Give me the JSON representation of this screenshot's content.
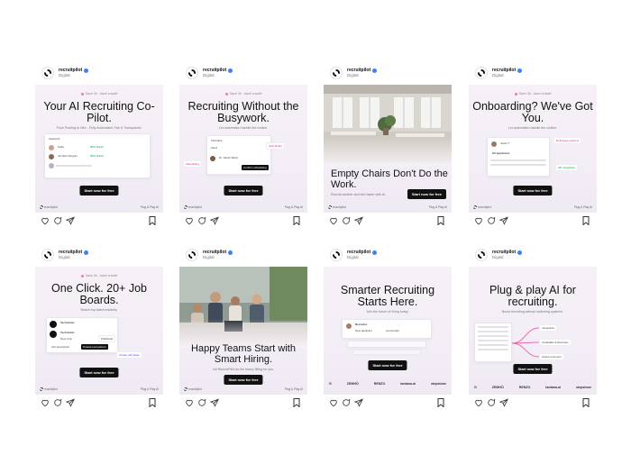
{
  "account": {
    "name": "recruitpilot",
    "subtitle": "Digital"
  },
  "promo_line": "Save 3h - have a seat!",
  "footer": {
    "brand": "recruitpilot",
    "right": "Plug & Play AI"
  },
  "cta_label": "Start now for free",
  "posts": [
    {
      "headline": "Your AI Recruiting Co-Pilot.",
      "subline": "From Posting to Hire - Fully Automated, Fair & Transparent.",
      "mock_labels": [
        "Applicant",
        "Sofia",
        "Jennifer Morgan",
        "98% Match",
        "Score"
      ]
    },
    {
      "headline": "Recruiting Without the Busywork.",
      "subline": "Let automation handle the routine.",
      "mock_labels": [
        "Schedule",
        "Send",
        "Dr. Sarah Ward",
        "Confirm scheduling",
        "Scheduling",
        "Auto-Reply"
      ]
    },
    {
      "headline": "Empty Chairs Don't Do the Work.",
      "subline": "Recruit smarter and hire faster with AI."
    },
    {
      "headline": "Onboarding? We've Got You.",
      "subline": "Let automation handle the routine.",
      "mock_labels": [
        "Justin T",
        "All applicants",
        "Upload",
        "Employee systems",
        "HR integration"
      ]
    },
    {
      "headline": "One Click. 20+ Job Boards.",
      "subline": "Reach top talent instantly.",
      "mock_labels": [
        "Technician",
        "Technician",
        "New York",
        "Published",
        "Job description",
        "Posted everywhere",
        "Create with Ease"
      ]
    },
    {
      "headline": "Happy Teams Start with Smart Hiring.",
      "subline": "Let RecruitPilot do the heavy lifting for you."
    },
    {
      "headline": "Smarter Recruiting Starts Here.",
      "subline": "Join the future of hiring today.",
      "mock_labels": [
        "Recruiter",
        "New applicant",
        "Accountant"
      ],
      "logos": [
        "G",
        "ZEMHÖ",
        "RENZO",
        "tantana.ai",
        "stepstone"
      ]
    },
    {
      "headline": "Plug & play AI for recruiting.",
      "subline": "Boost recruiting without switching systems.",
      "mock_labels": [
        "Integration",
        "Candidate & Recruiter",
        "Cloud connector"
      ],
      "logos": [
        "G",
        "ZEMHÖ",
        "RENZO",
        "tantana.ai",
        "stepstone"
      ]
    }
  ],
  "icons": [
    "heart-icon",
    "comment-icon",
    "share-icon",
    "bookmark-icon"
  ]
}
